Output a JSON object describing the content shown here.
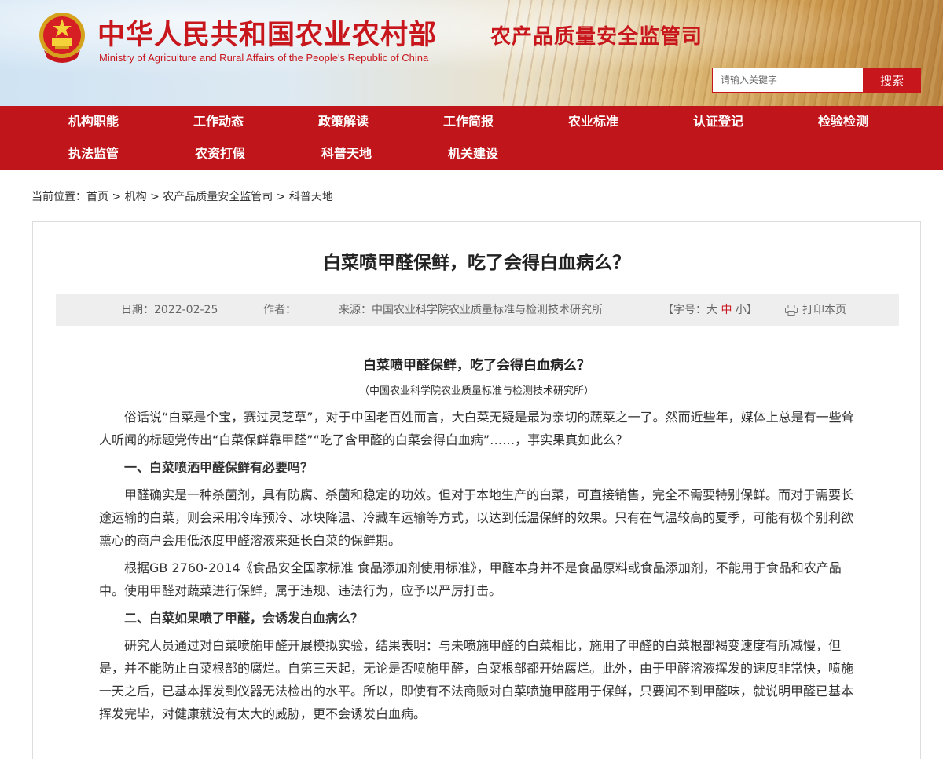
{
  "header": {
    "title_cn": "中华人民共和国农业农村部",
    "title_en": "Ministry of Agriculture and Rural Affairs of the People's Republic of China",
    "department": "农产品质量安全监管司",
    "search_placeholder": "请输入关键字",
    "search_button": "搜索"
  },
  "nav": {
    "row1": [
      "机构职能",
      "工作动态",
      "政策解读",
      "工作简报",
      "农业标准",
      "认证登记",
      "检验检测"
    ],
    "row2": [
      "执法监管",
      "农资打假",
      "科普天地",
      "机关建设"
    ]
  },
  "breadcrumb": {
    "prefix": "当前位置：",
    "items": [
      "首页",
      "机构",
      "农产品质量安全监管司",
      "科普天地"
    ],
    "sep": " > "
  },
  "article": {
    "title": "白菜喷甲醛保鲜，吃了会得白血病么？",
    "meta": {
      "date": "日期：2022-02-25",
      "author": "作者：",
      "source": "来源：中国农业科学院农业质量标准与检测技术研究所",
      "font_prefix": "【字号：",
      "font_large": "大",
      "font_medium": "中",
      "font_small": "小",
      "font_suffix": "】",
      "print": "打印本页"
    },
    "sub_title": "白菜喷甲醛保鲜，吃了会得白血病么？",
    "sub_source": "（中国农业科学院农业质量标准与检测技术研究所）",
    "paragraphs": [
      "俗话说“白菜是个宝，赛过灵芝草”，对于中国老百姓而言，大白菜无疑是最为亲切的蔬菜之一了。然而近些年，媒体上总是有一些耸人听闻的标题党传出“白菜保鲜靠甲醛”“吃了含甲醛的白菜会得白血病”……，事实果真如此么？",
      "一、白菜喷洒甲醛保鲜有必要吗？",
      "甲醛确实是一种杀菌剂，具有防腐、杀菌和稳定的功效。但对于本地生产的白菜，可直接销售，完全不需要特别保鲜。而对于需要长途运输的白菜，则会采用冷库预冷、冰块降温、冷藏车运输等方式，以达到低温保鲜的效果。只有在气温较高的夏季，可能有极个别利欲熏心的商户会用低浓度甲醛溶液来延长白菜的保鲜期。",
      "根据GB 2760-2014《食品安全国家标准 食品添加剂使用标准》，甲醛本身并不是食品原料或食品添加剂，不能用于食品和农产品中。使用甲醛对蔬菜进行保鲜，属于违规、违法行为，应予以严厉打击。",
      "二、白菜如果喷了甲醛，会诱发白血病么？",
      "研究人员通过对白菜喷施甲醛开展模拟实验，结果表明：与未喷施甲醛的白菜相比，施用了甲醛的白菜根部褐变速度有所减慢，但是，并不能防止白菜根部的腐烂。自第三天起，无论是否喷施甲醛，白菜根部都开始腐烂。此外，由于甲醛溶液挥发的速度非常快，喷施一天之后，已基本挥发到仪器无法检出的水平。所以，即使有不法商贩对白菜喷施甲醛用于保鲜，只要闻不到甲醛味，就说明甲醛已基本挥发完毕，对健康就没有太大的威胁，更不会诱发白血病。"
    ]
  }
}
